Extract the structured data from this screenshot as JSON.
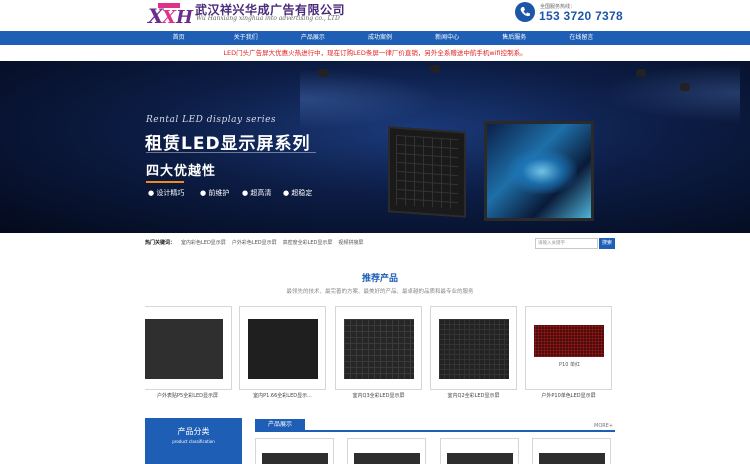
{
  "header": {
    "brand_cn": "武汉祥兴华成广告有限公司",
    "brand_en": "Wu Hanxiang xinghua into advertising co., LTD",
    "phone_label": "全国服务热线：",
    "phone_number": "153 3720 7378"
  },
  "nav": {
    "items": [
      {
        "label": "首页"
      },
      {
        "label": "关于我们"
      },
      {
        "label": "产品展示"
      },
      {
        "label": "成功案例"
      },
      {
        "label": "新闻中心"
      },
      {
        "label": "售后服务"
      },
      {
        "label": "在线留言"
      }
    ]
  },
  "notice": "LED门头广告屏大优惠火热进行中，现在订购LED条屏一律厂价直销，另外全系赠送中航手机wifi控制系。",
  "banner": {
    "subtitle": "Rental LED display series",
    "title": "租赁LED显示屏系列",
    "advantages": "四大优越性",
    "features": [
      "设计精巧",
      "前维护",
      "超高清",
      "超稳定"
    ]
  },
  "hot": {
    "label": "热门关键词：",
    "keywords": [
      "室内彩色LED显示屏",
      "户外彩色LED显示屏",
      "高密度全彩LED显示屏",
      "视频拼接屏"
    ]
  },
  "search": {
    "placeholder": "请输入关键字",
    "button": "搜索"
  },
  "recommend": {
    "title": "推荐产品",
    "subtitle": "最领先的技术、最完善的方案、最美好的产品、最卓越的品质和最专业的服务",
    "products": [
      {
        "caption": "户外表贴P5全彩LED显示屏"
      },
      {
        "caption": "室内P1.66全彩LED显示..."
      },
      {
        "caption": "室内Q3全彩LED显示屏"
      },
      {
        "caption": "室内Q2全彩LED显示屏"
      },
      {
        "caption": "户外P10单色LED显示屏"
      }
    ],
    "p10_label": "P10 单红"
  },
  "category": {
    "title": "产品分类",
    "subtitle": "product classification"
  },
  "showcase": {
    "tab": "产品展示",
    "more": "MORE+"
  },
  "colors": {
    "primary": "#1e5fb5",
    "notice": "#e02020",
    "accent": "#f08a1d"
  }
}
